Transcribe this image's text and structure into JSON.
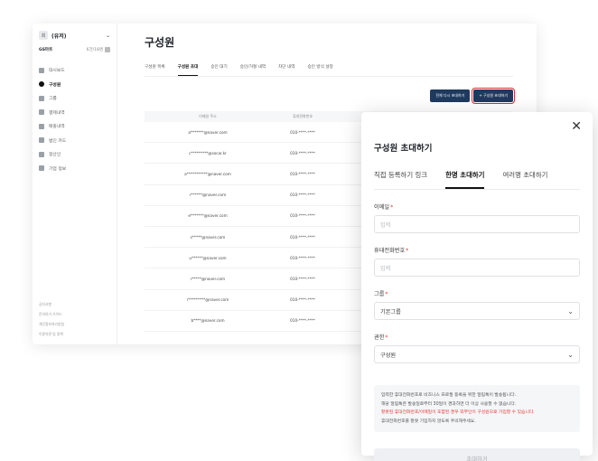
{
  "sidebar": {
    "org_name": "(유저)",
    "org_logo": "회",
    "plan_label": "GS마트",
    "plan_count": "6건/18명",
    "items": [
      {
        "label": "대시보드",
        "icon": "home-icon"
      },
      {
        "label": "구성원",
        "icon": "person-icon",
        "active": true
      },
      {
        "label": "그룹",
        "icon": "group-icon"
      },
      {
        "label": "결제내역",
        "icon": "document-icon"
      },
      {
        "label": "매출내역",
        "icon": "document-icon"
      },
      {
        "label": "법인 카드",
        "icon": "card-icon"
      },
      {
        "label": "정산인",
        "icon": "gear-icon"
      },
      {
        "label": "기업 정보",
        "icon": "building-icon"
      }
    ],
    "footer": [
      "공지사항",
      "문의하기 가이드",
      "개인정보처리방침",
      "이용약관 및 정책"
    ]
  },
  "main": {
    "title": "구성원",
    "tabs": [
      "구성원 목록",
      "구성원 초대",
      "승인 대기",
      "승인/거절 내역",
      "차단 내역",
      "승인 방식 설정"
    ],
    "active_tab": 1,
    "actions": {
      "resend": "전체 다시 초대하기",
      "invite": "+ 구성원 초대하기"
    },
    "table": {
      "headers": [
        "이메일 주소",
        "휴대전화번호"
      ],
      "rows": [
        [
          "a*******@naver.com",
          "010-****-****"
        ],
        [
          "c*********@socar.kr",
          "010-****-****"
        ],
        [
          "a***********@naver.com",
          "010-****-****"
        ],
        [
          "r******@naver.com",
          "010-****-****"
        ],
        [
          "e*******@naver.com",
          "010-****-****"
        ],
        [
          "s*****@naver.com",
          "010-****-****"
        ],
        [
          "u******@naver.com",
          "010-****-****"
        ],
        [
          "r*****@naver.com",
          "010-****-****"
        ],
        [
          "r*********@naver.com",
          "010-****-****"
        ],
        [
          "b****@naver.com",
          "010-****-****"
        ]
      ]
    }
  },
  "modal": {
    "title": "구성원 초대하기",
    "tabs": [
      "직접 등록하기 링크",
      "한명 초대하기",
      "여러명 초대하기"
    ],
    "active_tab": 1,
    "email": {
      "label": "이메일",
      "placeholder": "입력"
    },
    "phone": {
      "label": "휴대전화번호",
      "placeholder": "입력"
    },
    "group": {
      "label": "그룹",
      "value": "기본그룹"
    },
    "role": {
      "label": "권한",
      "value": "구성원"
    },
    "notice": [
      "입력한 휴대전화번호로 비즈니스 프로필 등록을 위한 알림톡이 발송됩니다.",
      "해당 알림톡은 발송일로부터 30일이 경과하면 더 이상 사용할 수 없습니다."
    ],
    "warning": "잘못된 휴대전화번호/이메일이 포함된 경우 외부인이 구성원으로 가입할 수 있습니다.",
    "notice_tail": "휴대전화번호를 잘못 기입하지 않도록 주의해주세요.",
    "submit": "초대하기",
    "colors": {
      "accent": "#1f3a5f",
      "required": "#e53935",
      "highlight": "#d32f2f"
    }
  }
}
